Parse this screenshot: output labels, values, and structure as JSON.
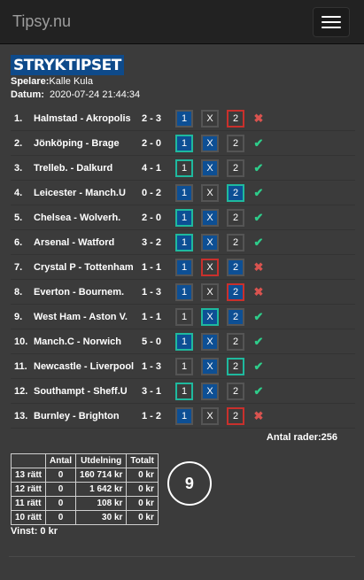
{
  "navbar": {
    "brand": "Tipsy.nu"
  },
  "coupon": {
    "logo_text": "STRYKTIPSET",
    "player_label": "Spelare:",
    "player_name": "Kalle Kula",
    "date_label": "Datum:",
    "date_value": "2020-07-24 21:44:34"
  },
  "matches": [
    {
      "num": "1.",
      "match": "Halmstad - Akropolis",
      "score": "2 - 3",
      "options": [
        {
          "t": "1",
          "sel": true,
          "state": ""
        },
        {
          "t": "X",
          "sel": false,
          "state": ""
        },
        {
          "t": "2",
          "sel": false,
          "state": "wrong"
        }
      ],
      "result": "wrong"
    },
    {
      "num": "2.",
      "match": "Jönköping - Brage",
      "score": "2 - 0",
      "options": [
        {
          "t": "1",
          "sel": true,
          "state": "correct"
        },
        {
          "t": "X",
          "sel": true,
          "state": ""
        },
        {
          "t": "2",
          "sel": false,
          "state": ""
        }
      ],
      "result": "correct"
    },
    {
      "num": "3.",
      "match": "Trelleb. - Dalkurd",
      "score": "4 - 1",
      "options": [
        {
          "t": "1",
          "sel": false,
          "state": "correct"
        },
        {
          "t": "X",
          "sel": true,
          "state": ""
        },
        {
          "t": "2",
          "sel": false,
          "state": ""
        }
      ],
      "result": "correct"
    },
    {
      "num": "4.",
      "match": "Leicester - Manch.U",
      "score": "0 - 2",
      "options": [
        {
          "t": "1",
          "sel": true,
          "state": ""
        },
        {
          "t": "X",
          "sel": false,
          "state": ""
        },
        {
          "t": "2",
          "sel": true,
          "state": "correct"
        }
      ],
      "result": "correct"
    },
    {
      "num": "5.",
      "match": "Chelsea - Wolverh.",
      "score": "2 - 0",
      "options": [
        {
          "t": "1",
          "sel": true,
          "state": "correct"
        },
        {
          "t": "X",
          "sel": true,
          "state": ""
        },
        {
          "t": "2",
          "sel": false,
          "state": ""
        }
      ],
      "result": "correct"
    },
    {
      "num": "6.",
      "match": "Arsenal - Watford",
      "score": "3 - 2",
      "options": [
        {
          "t": "1",
          "sel": true,
          "state": "correct"
        },
        {
          "t": "X",
          "sel": true,
          "state": ""
        },
        {
          "t": "2",
          "sel": false,
          "state": ""
        }
      ],
      "result": "correct"
    },
    {
      "num": "7.",
      "match": "Crystal P - Tottenham",
      "score": "1 - 1",
      "options": [
        {
          "t": "1",
          "sel": true,
          "state": ""
        },
        {
          "t": "X",
          "sel": false,
          "state": "wrong"
        },
        {
          "t": "2",
          "sel": true,
          "state": ""
        }
      ],
      "result": "wrong"
    },
    {
      "num": "8.",
      "match": "Everton - Bournem.",
      "score": "1 - 3",
      "options": [
        {
          "t": "1",
          "sel": true,
          "state": ""
        },
        {
          "t": "X",
          "sel": false,
          "state": ""
        },
        {
          "t": "2",
          "sel": true,
          "state": "wrong"
        }
      ],
      "result": "wrong"
    },
    {
      "num": "9.",
      "match": "West Ham - Aston V.",
      "score": "1 - 1",
      "options": [
        {
          "t": "1",
          "sel": false,
          "state": ""
        },
        {
          "t": "X",
          "sel": true,
          "state": "correct"
        },
        {
          "t": "2",
          "sel": true,
          "state": ""
        }
      ],
      "result": "correct"
    },
    {
      "num": "10.",
      "match": "Manch.C - Norwich",
      "score": "5 - 0",
      "options": [
        {
          "t": "1",
          "sel": true,
          "state": "correct"
        },
        {
          "t": "X",
          "sel": true,
          "state": ""
        },
        {
          "t": "2",
          "sel": false,
          "state": ""
        }
      ],
      "result": "correct"
    },
    {
      "num": "11.",
      "match": "Newcastle - Liverpool",
      "score": "1 - 3",
      "options": [
        {
          "t": "1",
          "sel": false,
          "state": ""
        },
        {
          "t": "X",
          "sel": true,
          "state": ""
        },
        {
          "t": "2",
          "sel": false,
          "state": "correct"
        }
      ],
      "result": "correct"
    },
    {
      "num": "12.",
      "match": "Southampt - Sheff.U",
      "score": "3 - 1",
      "options": [
        {
          "t": "1",
          "sel": false,
          "state": "correct"
        },
        {
          "t": "X",
          "sel": true,
          "state": ""
        },
        {
          "t": "2",
          "sel": false,
          "state": ""
        }
      ],
      "result": "correct"
    },
    {
      "num": "13.",
      "match": "Burnley - Brighton",
      "score": "1 - 2",
      "options": [
        {
          "t": "1",
          "sel": true,
          "state": ""
        },
        {
          "t": "X",
          "sel": false,
          "state": ""
        },
        {
          "t": "2",
          "sel": false,
          "state": "wrong"
        }
      ],
      "result": "wrong"
    }
  ],
  "antal_rader": "Antal rader:256",
  "prize_table": {
    "headers": [
      "",
      "Antal",
      "Utdelning",
      "Totalt"
    ],
    "rows": [
      [
        "13 rätt",
        "0",
        "160 714 kr",
        "0 kr"
      ],
      [
        "12 rätt",
        "0",
        "1 642 kr",
        "0 kr"
      ],
      [
        "11 rätt",
        "0",
        "108 kr",
        "0 kr"
      ],
      [
        "10 rätt",
        "0",
        "30 kr",
        "0 kr"
      ]
    ]
  },
  "correct_count": "9",
  "vinst": "Vinst: 0 kr",
  "colors": {
    "selected": "#0d4f94",
    "correct_border": "#1fb99e",
    "wrong_border": "#c9302c",
    "check": "#2ecc8a",
    "cross": "#d9534f"
  },
  "icons": {
    "correct": "check-icon",
    "wrong": "cross-icon",
    "menu": "hamburger-icon"
  }
}
